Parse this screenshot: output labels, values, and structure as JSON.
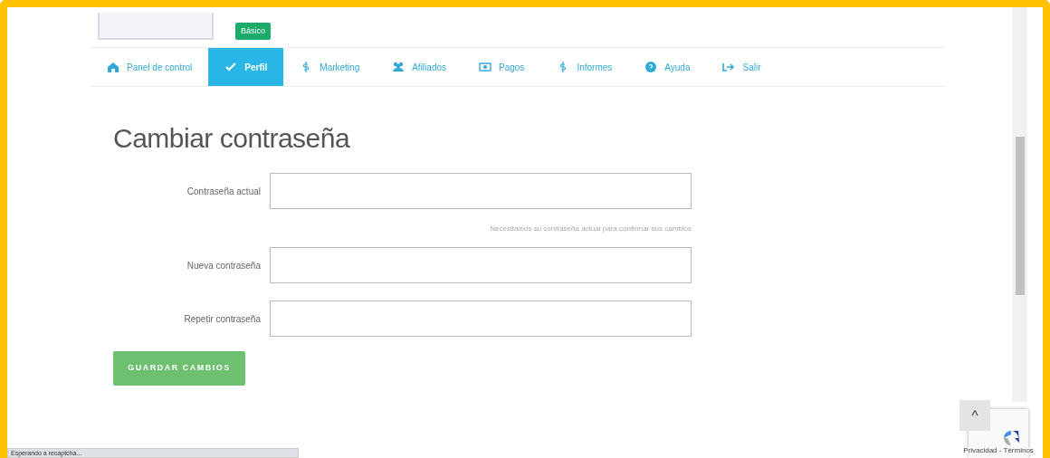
{
  "profile": {
    "badge": "Básico"
  },
  "nav": [
    {
      "label": "Panel de control",
      "kind": "home",
      "selected": false
    },
    {
      "label": "Perfil",
      "kind": "check",
      "selected": true
    },
    {
      "label": "Marketing",
      "kind": "dollar",
      "selected": false
    },
    {
      "label": "Afiliados",
      "kind": "users",
      "selected": false
    },
    {
      "label": "Pagos",
      "kind": "money",
      "selected": false
    },
    {
      "label": "Informes",
      "kind": "dollar",
      "selected": false
    },
    {
      "label": "Ayuda",
      "kind": "help",
      "selected": false
    },
    {
      "label": "Salir",
      "kind": "exit",
      "selected": false
    }
  ],
  "form": {
    "title": "Cambiar contraseña",
    "fields": [
      {
        "label": "Contraseña actual",
        "help": "Necesitamos su contraseña actual para confirmar sus cambios"
      },
      {
        "label": "Nueva contraseña"
      },
      {
        "label": "Repetir contraseña"
      }
    ],
    "submit": "GUARDAR CAMBIOS"
  },
  "back_to_top": "^",
  "recaptcha": {
    "terms": "Privacidad - Términos"
  },
  "status_bar": "Esperando a recaptcha..."
}
